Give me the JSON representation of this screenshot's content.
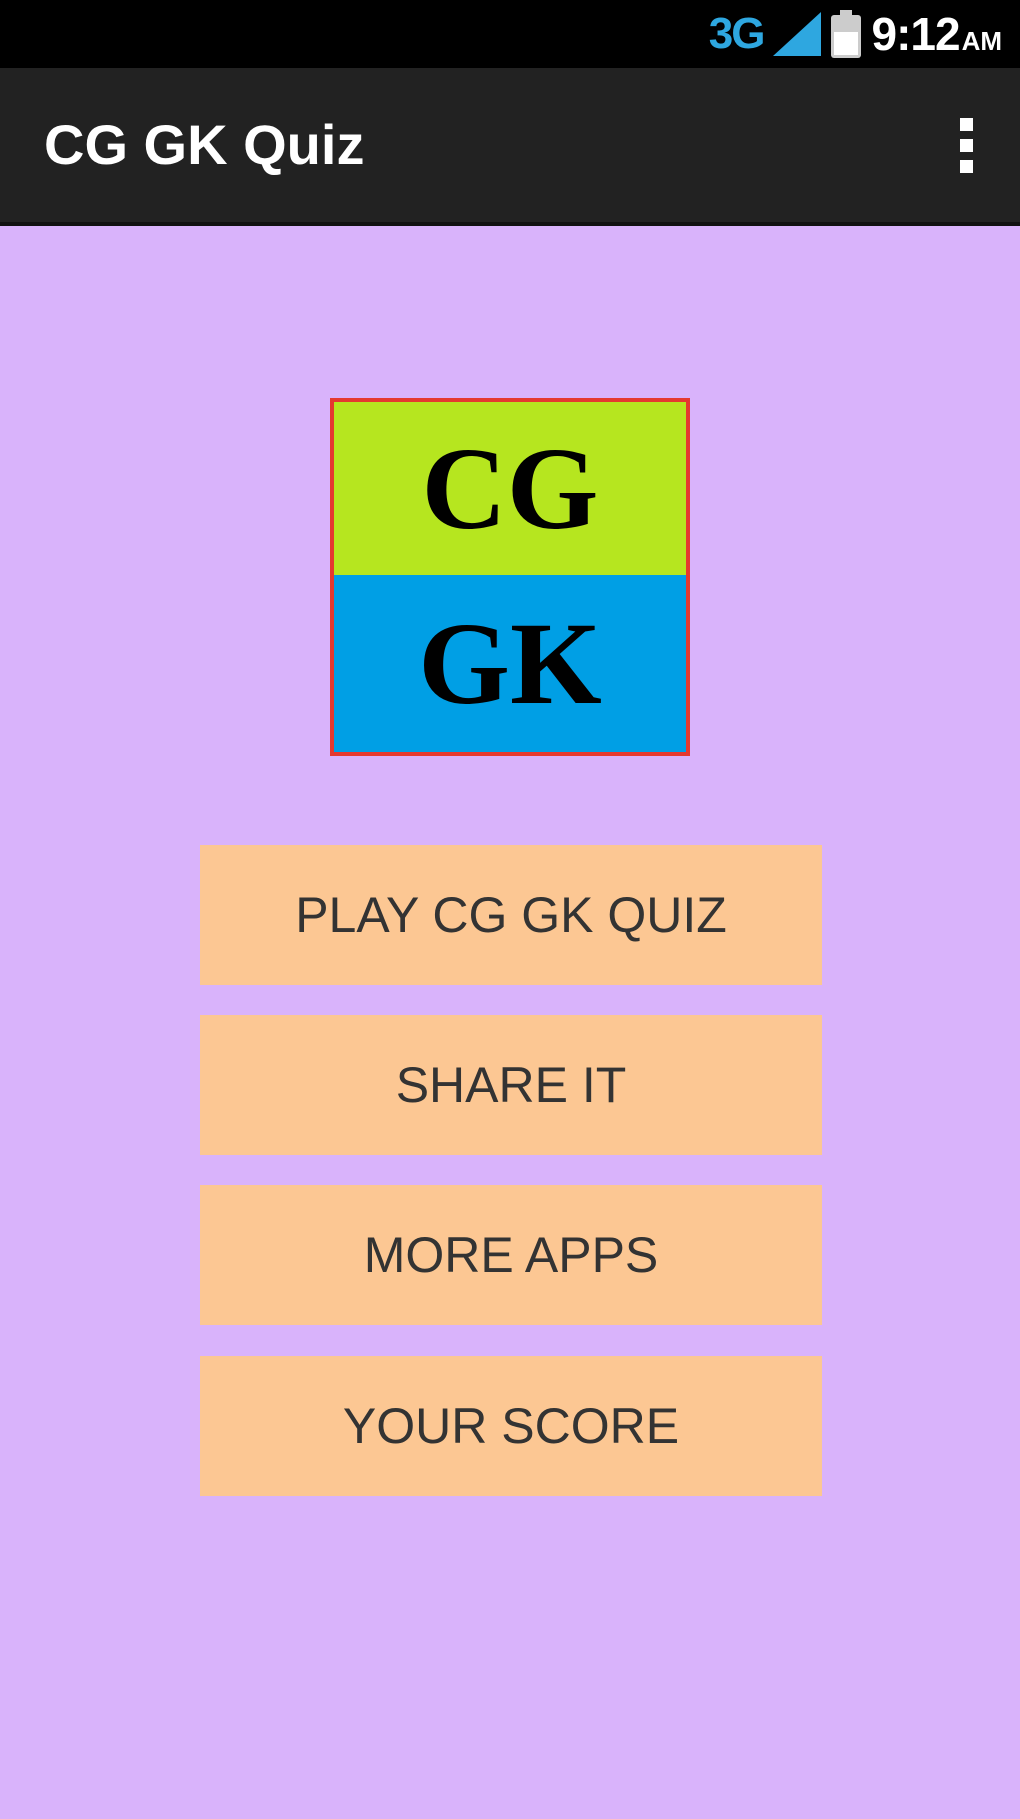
{
  "status_bar": {
    "network": "3G",
    "time": "9:12",
    "ampm": "AM",
    "icons": [
      "signal-icon",
      "battery-icon"
    ]
  },
  "action_bar": {
    "title": "CG GK Quiz",
    "menu_icon": "overflow-menu-icon"
  },
  "logo": {
    "top_text": "CG",
    "bottom_text": "GK",
    "colors": {
      "top": "#b6e61f",
      "bottom": "#009fe5",
      "border": "#e5392f"
    }
  },
  "buttons": {
    "play": "PLAY CG GK QUIZ",
    "share": "SHARE IT",
    "more_apps": "MORE APPS",
    "score": "YOUR SCORE"
  },
  "colors": {
    "background": "#d9b3fb",
    "button": "#fcc793",
    "action_bar": "#222222",
    "status_bar": "#000000",
    "network_accent": "#2ea7e0"
  }
}
